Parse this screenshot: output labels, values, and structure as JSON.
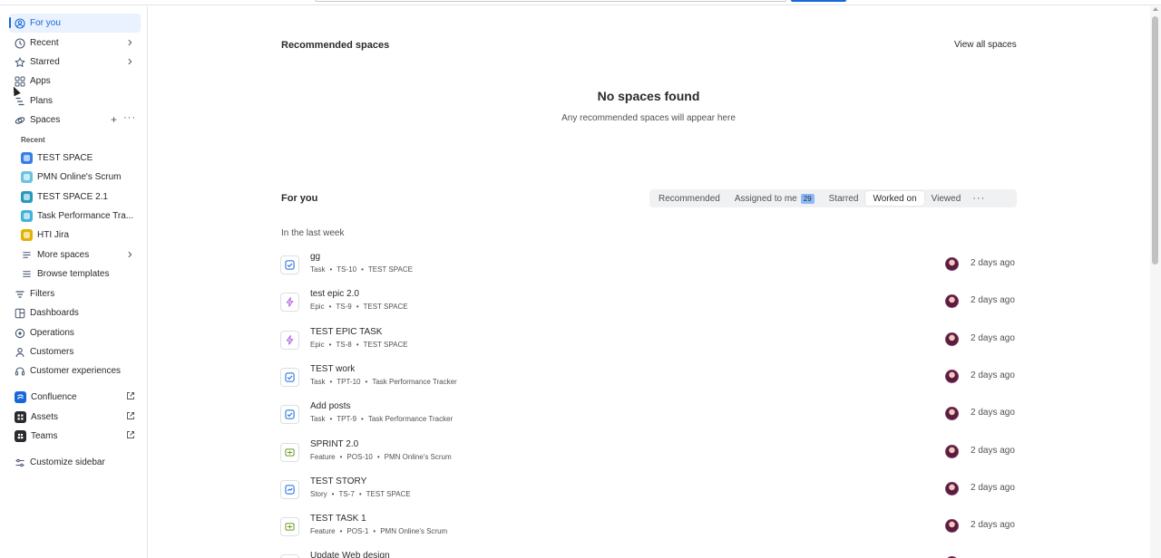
{
  "sidebar": {
    "nav": [
      {
        "label": "For you",
        "icon": "user-circle-icon"
      },
      {
        "label": "Recent",
        "icon": "clock-icon"
      },
      {
        "label": "Starred",
        "icon": "star-icon"
      },
      {
        "label": "Apps",
        "icon": "apps-grid-icon"
      },
      {
        "label": "Plans",
        "icon": "plans-icon"
      },
      {
        "label": "Spaces",
        "icon": "spaces-icon"
      }
    ],
    "recent_label": "Recent",
    "spaces": [
      {
        "label": "TEST SPACE",
        "color": "#357de8"
      },
      {
        "label": "PMN Online's Scrum",
        "color": "#6cc3e0"
      },
      {
        "label": "TEST SPACE 2.1",
        "color": "#2898bd"
      },
      {
        "label": "Task Performance Tra...",
        "color": "#42b2d7"
      },
      {
        "label": "HTI Jira",
        "color": "#e2b203"
      }
    ],
    "more_spaces": "More spaces",
    "browse_templates": "Browse templates",
    "bottom_nav": [
      {
        "label": "Filters",
        "icon": "filter-icon"
      },
      {
        "label": "Dashboards",
        "icon": "dashboard-icon"
      },
      {
        "label": "Operations",
        "icon": "operations-icon"
      },
      {
        "label": "Customers",
        "icon": "person-icon"
      },
      {
        "label": "Customer experiences",
        "icon": "headset-icon"
      }
    ],
    "apps": [
      {
        "label": "Confluence",
        "icon": "confluence-icon",
        "color": "#1868db"
      },
      {
        "label": "Assets",
        "icon": "assets-icon",
        "color": "#292a2e"
      },
      {
        "label": "Teams",
        "icon": "teams-icon",
        "color": "#292a2e"
      }
    ],
    "customize": "Customize sidebar"
  },
  "recommended": {
    "heading": "Recommended spaces",
    "view_all": "View all spaces",
    "empty_title": "No spaces found",
    "empty_sub": "Any recommended spaces will appear here"
  },
  "for_you": {
    "heading": "For you",
    "tabs": [
      "Recommended",
      "Assigned to me",
      "Starred",
      "Worked on",
      "Viewed"
    ],
    "assigned_count": "29",
    "selected_tab": "Worked on",
    "section": "In the last week",
    "items": [
      {
        "title": "gg",
        "type": "Task",
        "key": "TS-10",
        "space": "TEST SPACE",
        "when": "2 days ago",
        "icon": "task-icon"
      },
      {
        "title": "test epic 2.0",
        "type": "Epic",
        "key": "TS-9",
        "space": "TEST SPACE",
        "when": "2 days ago",
        "icon": "epic-icon"
      },
      {
        "title": "TEST EPIC TASK",
        "type": "Epic",
        "key": "TS-8",
        "space": "TEST SPACE",
        "when": "2 days ago",
        "icon": "epic-icon"
      },
      {
        "title": "TEST work",
        "type": "Task",
        "key": "TPT-10",
        "space": "Task Performance Tracker",
        "when": "2 days ago",
        "icon": "task-icon"
      },
      {
        "title": "Add posts",
        "type": "Task",
        "key": "TPT-9",
        "space": "Task Performance Tracker",
        "when": "2 days ago",
        "icon": "task-icon"
      },
      {
        "title": "SPRINT 2.0",
        "type": "Feature",
        "key": "POS-10",
        "space": "PMN Online's Scrum",
        "when": "2 days ago",
        "icon": "feature-icon"
      },
      {
        "title": "TEST STORY",
        "type": "Story",
        "key": "TS-7",
        "space": "TEST SPACE",
        "when": "2 days ago",
        "icon": "story-icon"
      },
      {
        "title": "TEST TASK 1",
        "type": "Feature",
        "key": "POS-1",
        "space": "PMN Online's Scrum",
        "when": "2 days ago",
        "icon": "feature-icon"
      },
      {
        "title": "Update Web design",
        "type": "",
        "key": "",
        "space": "",
        "when": "",
        "icon": "task-icon"
      }
    ]
  },
  "colors": {
    "accent": "#1868db",
    "selected_bg": "#e9f2fe",
    "task": "#1868db",
    "epic": "#a54fe0",
    "feature": "#6a9a23"
  }
}
